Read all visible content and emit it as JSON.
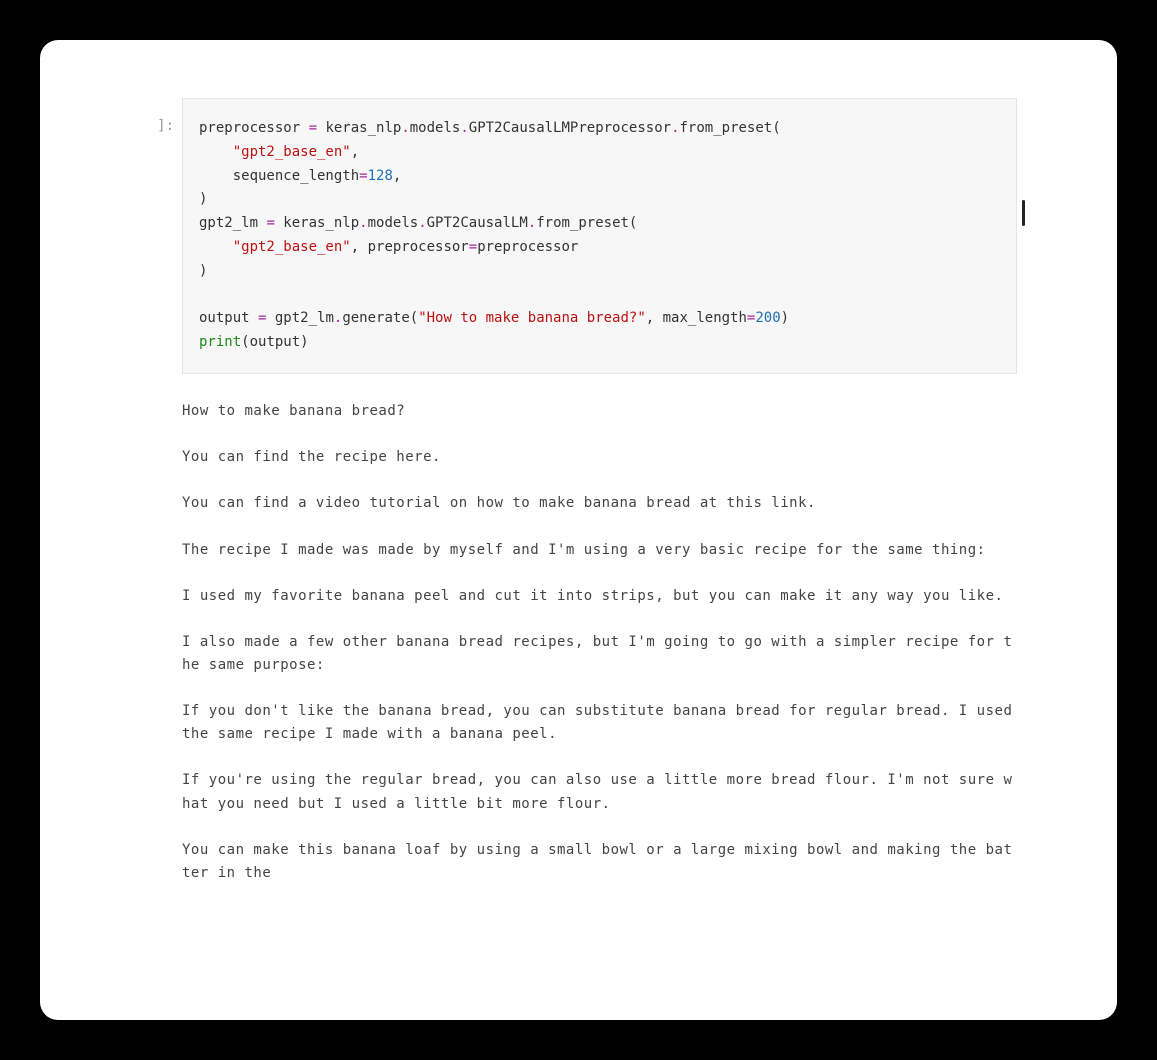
{
  "prompt_label": "]:",
  "code": {
    "line1": {
      "a": "preprocessor ",
      "op": "=",
      "b": " keras_nlp",
      "dot1": ".",
      "c": "models",
      "dot2": ".",
      "d": "GPT2CausalLMPreprocessor",
      "dot3": ".",
      "e": "from_preset("
    },
    "line2": {
      "indent": "    ",
      "str": "\"gpt2_base_en\"",
      "comma": ","
    },
    "line3": {
      "indent": "    ",
      "a": "sequence_length",
      "op": "=",
      "num": "128",
      "comma": ","
    },
    "line4": {
      "a": ")"
    },
    "line5": {
      "a": "gpt2_lm ",
      "op": "=",
      "b": " keras_nlp",
      "dot1": ".",
      "c": "models",
      "dot2": ".",
      "d": "GPT2CausalLM",
      "dot3": ".",
      "e": "from_preset("
    },
    "line6": {
      "indent": "    ",
      "str": "\"gpt2_base_en\"",
      "comma": ", ",
      "a": "preprocessor",
      "op": "=",
      "b": "preprocessor"
    },
    "line7": {
      "a": ")"
    },
    "blank": "",
    "line8": {
      "a": "output ",
      "op": "=",
      "b": " gpt2_lm",
      "dot": ".",
      "c": "generate(",
      "str": "\"How to make banana bread?\"",
      "comma": ", ",
      "d": "max_length",
      "op2": "=",
      "num": "200",
      "e": ")"
    },
    "line9": {
      "builtin": "print",
      "a": "(output)"
    }
  },
  "output_text": "How to make banana bread?\n\nYou can find the recipe here.\n\nYou can find a video tutorial on how to make banana bread at this link.\n\nThe recipe I made was made by myself and I'm using a very basic recipe for the same thing:\n\nI used my favorite banana peel and cut it into strips, but you can make it any way you like.\n\nI also made a few other banana bread recipes, but I'm going to go with a simpler recipe for the same purpose:\n\nIf you don't like the banana bread, you can substitute banana bread for regular bread. I used the same recipe I made with a banana peel.\n\nIf you're using the regular bread, you can also use a little more bread flour. I'm not sure what you need but I used a little bit more flour.\n\nYou can make this banana loaf by using a small bowl or a large mixing bowl and making the batter in the"
}
